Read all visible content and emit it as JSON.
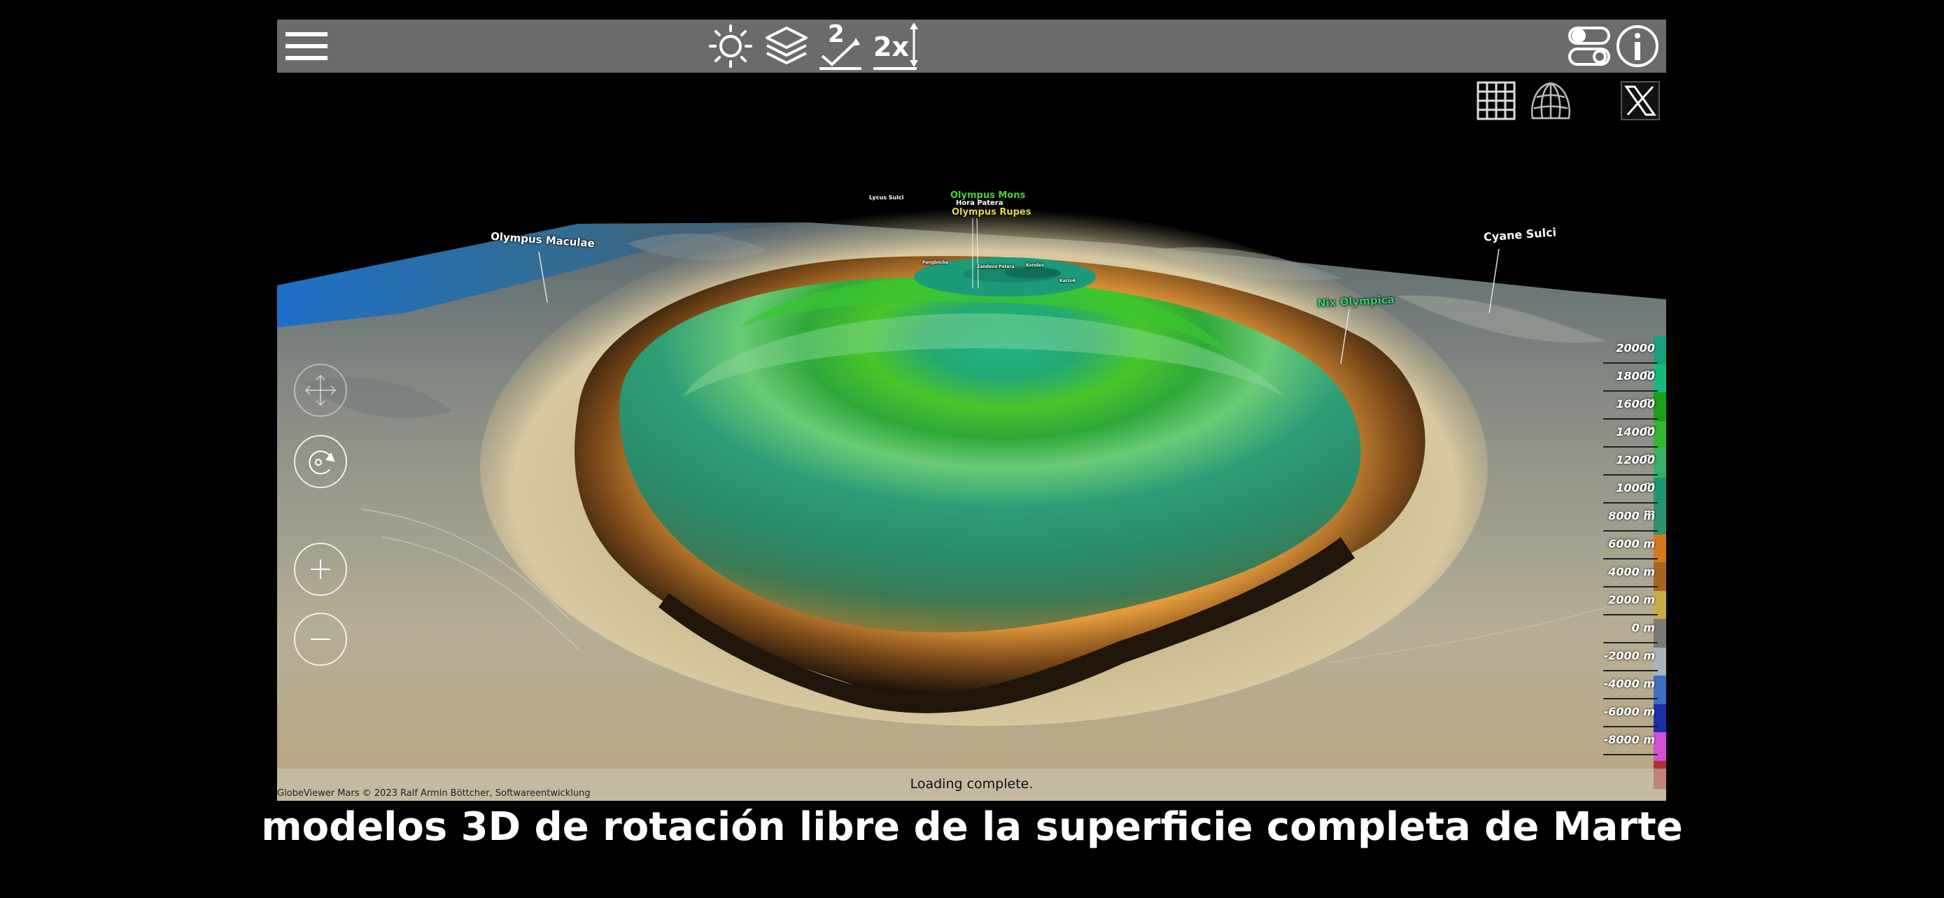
{
  "toolbar": {
    "buttons": [
      {
        "name": "menu-icon"
      },
      {
        "name": "sun-icon"
      },
      {
        "name": "layers-icon"
      },
      {
        "name": "dimension-2d-icon",
        "text": "2"
      },
      {
        "name": "elevation-scale-icon",
        "text": "2x"
      },
      {
        "name": "toggle-settings-icon"
      },
      {
        "name": "info-icon",
        "text": "i"
      }
    ]
  },
  "view_options": [
    {
      "name": "grid-icon"
    },
    {
      "name": "globe-grid-icon"
    },
    {
      "name": "x-logo-icon"
    }
  ],
  "map_labels": {
    "olympus_maculae": "Olympus Maculae",
    "lycus_sulci": "Lycus Sulci",
    "olympus_mons": "Olympus Mons",
    "hora_patera": "Hora Patera",
    "olympus_rupes": "Olympus Rupes",
    "cyane_sulci": "Cyane Sulci",
    "nix_olympica": "Nix Olympica",
    "small_1": "Pangboche",
    "small_2": "Karzok",
    "small_3": "Zandeva Patera",
    "small_4": "Korolev"
  },
  "legend": {
    "ticks": [
      "20000 m",
      "18000 m",
      "16000 m",
      "14000 m",
      "12000 m",
      "10000 m",
      "8000 m",
      "6000 m",
      "4000 m",
      "2000 m",
      "0 m",
      "-2000 m",
      "-4000 m",
      "-6000 m",
      "-8000 m"
    ],
    "colors": [
      "#18a080",
      "#17b97a",
      "#1aa019",
      "#2fb830",
      "#36b06a",
      "#1d9872",
      "#29946e",
      "#d47a1c",
      "#a86522",
      "#c9ac45",
      "#7a7a78",
      "#a9b2b8",
      "#3d6fc2",
      "#1d2fa8",
      "#d54ed8",
      "#b03232"
    ]
  },
  "controls": {
    "pan": "pan-control-icon",
    "rotate": "rotate-control-icon",
    "zoom_in": "zoom-in-icon",
    "zoom_out": "zoom-out-icon"
  },
  "status": "Loading complete.",
  "copyright": "GlobeViewer Mars © 2023 Ralf Armin Böttcher, Softwareentwicklung",
  "caption": "modelos 3D de rotación libre de la superficie completa de Marte"
}
